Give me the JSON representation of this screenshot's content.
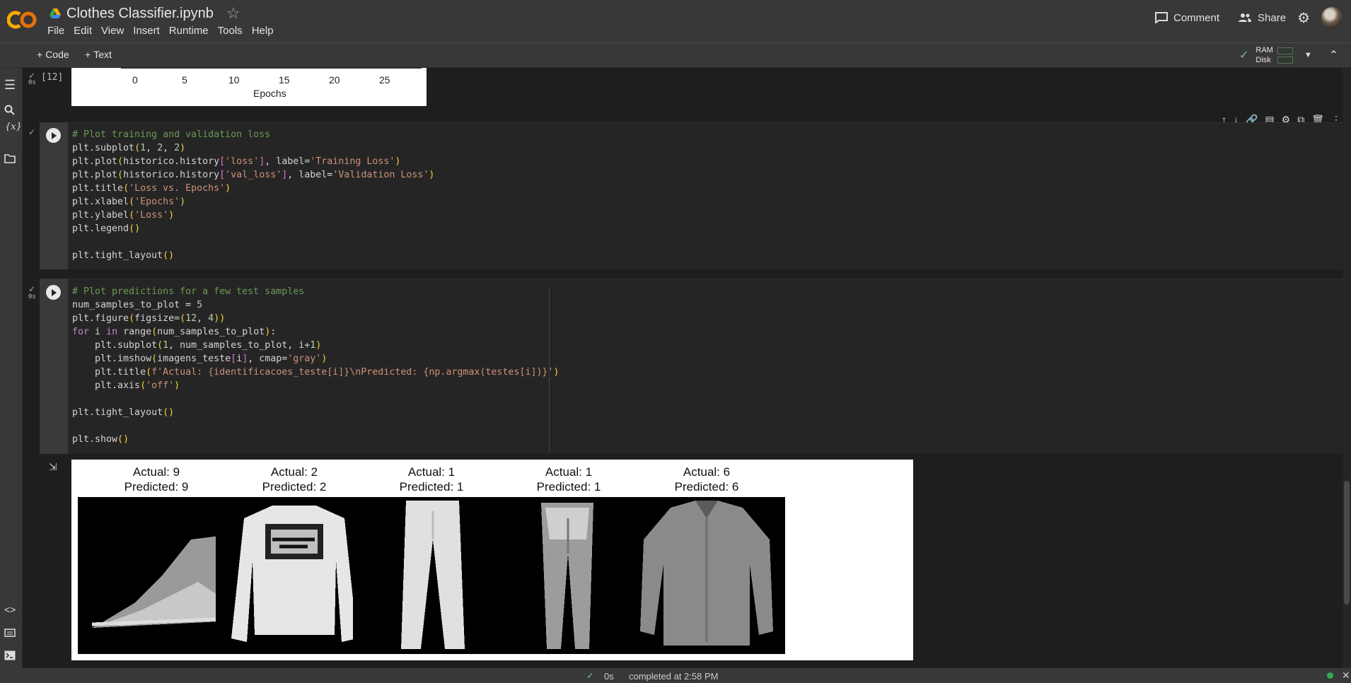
{
  "header": {
    "notebook_title": "Clothes Classifier.ipynb",
    "menu": [
      "File",
      "Edit",
      "View",
      "Insert",
      "Runtime",
      "Tools",
      "Help"
    ],
    "comment_label": "Comment",
    "share_label": "Share"
  },
  "toolbar": {
    "add_code_label": "Code",
    "add_text_label": "Text",
    "ram_label": "RAM",
    "disk_label": "Disk"
  },
  "cells": {
    "prev_output": {
      "exec_count": "[12]",
      "exec_time": "0s",
      "xticks": [
        "0",
        "5",
        "10",
        "15",
        "20",
        "25"
      ],
      "xlabel": "Epochs"
    },
    "loss_cell": {
      "lines": [
        "# Plot training and validation loss",
        "plt.subplot(1, 2, 2)",
        "plt.plot(historico.history['loss'], label='Training Loss')",
        "plt.plot(historico.history['val_loss'], label='Validation Loss')",
        "plt.title('Loss vs. Epochs')",
        "plt.xlabel('Epochs')",
        "plt.ylabel('Loss')",
        "plt.legend()",
        "",
        "plt.tight_layout()"
      ]
    },
    "predict_cell": {
      "exec_time": "0s",
      "lines": [
        "# Plot predictions for a few test samples",
        "num_samples_to_plot = 5",
        "plt.figure(figsize=(12, 4))",
        "for i in range(num_samples_to_plot):",
        "    plt.subplot(1, num_samples_to_plot, i+1)",
        "    plt.imshow(imagens_teste[i], cmap='gray')",
        "    plt.title(f'Actual: {identificacoes_teste[i]}\\nPredicted: {np.argmax(testes[i])}')",
        "    plt.axis('off')",
        "",
        "plt.tight_layout()",
        "",
        "plt.show()"
      ]
    },
    "predictions_output": {
      "panels": [
        {
          "actual": "Actual: 9",
          "predicted": "Predicted: 9",
          "item": "sneaker"
        },
        {
          "actual": "Actual: 2",
          "predicted": "Predicted: 2",
          "item": "pullover"
        },
        {
          "actual": "Actual: 1",
          "predicted": "Predicted: 1",
          "item": "trouser"
        },
        {
          "actual": "Actual: 1",
          "predicted": "Predicted: 1",
          "item": "trouser"
        },
        {
          "actual": "Actual: 6",
          "predicted": "Predicted: 6",
          "item": "shirt"
        }
      ]
    }
  },
  "status_bar": {
    "duration": "0s",
    "completed": "completed at 2:58 PM"
  },
  "colors": {
    "accent_orange": "#f9ab00",
    "check_green": "#7fbf7f",
    "background": "#1e1e1e"
  }
}
